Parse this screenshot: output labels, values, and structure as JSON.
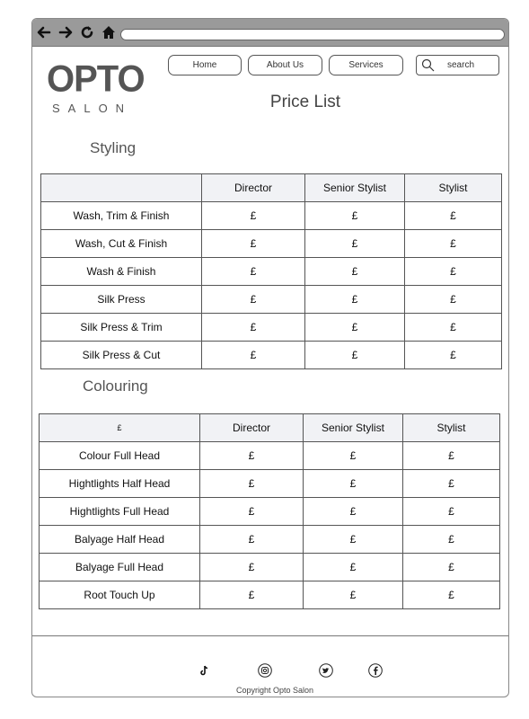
{
  "browser": {
    "icons": [
      "back-arrow-icon",
      "forward-arrow-icon",
      "reload-icon",
      "home-icon"
    ]
  },
  "logo": {
    "main": "OPTO",
    "sub": "SALON"
  },
  "nav": {
    "items": [
      {
        "label": "Home"
      },
      {
        "label": "About Us"
      },
      {
        "label": "Services"
      }
    ],
    "search_label": "search"
  },
  "page_title": "Price List",
  "styling": {
    "heading": "Styling",
    "corner": "",
    "columns": [
      "Director",
      "Senior Stylist",
      "Stylist"
    ],
    "rows": [
      {
        "service": "Wash, Trim & Finish",
        "prices": [
          "£",
          "£",
          "£"
        ]
      },
      {
        "service": "Wash, Cut & Finish",
        "prices": [
          "£",
          "£",
          "£"
        ]
      },
      {
        "service": "Wash & Finish",
        "prices": [
          "£",
          "£",
          "£"
        ]
      },
      {
        "service": "Silk Press",
        "prices": [
          "£",
          "£",
          "£"
        ]
      },
      {
        "service": "Silk Press & Trim",
        "prices": [
          "£",
          "£",
          "£"
        ]
      },
      {
        "service": "Silk Press & Cut",
        "prices": [
          "£",
          "£",
          "£"
        ]
      }
    ]
  },
  "colouring": {
    "heading": "Colouring",
    "corner": "£",
    "columns": [
      "Director",
      "Senior Stylist",
      "Stylist"
    ],
    "rows": [
      {
        "service": "Colour Full Head",
        "prices": [
          "£",
          "£",
          "£"
        ]
      },
      {
        "service": "Hightlights Half Head",
        "prices": [
          "£",
          "£",
          "£"
        ]
      },
      {
        "service": "Hightlights Full Head",
        "prices": [
          "£",
          "£",
          "£"
        ]
      },
      {
        "service": "Balyage Half Head",
        "prices": [
          "£",
          "£",
          "£"
        ]
      },
      {
        "service": "Balyage Full Head",
        "prices": [
          "£",
          "£",
          "£"
        ]
      },
      {
        "service": "Root Touch Up",
        "prices": [
          "£",
          "£",
          "£"
        ]
      }
    ]
  },
  "footer": {
    "social_icons": [
      "tiktok-icon",
      "instagram-icon",
      "twitter-icon",
      "facebook-icon"
    ],
    "copyright": "Copyright Opto Salon"
  }
}
